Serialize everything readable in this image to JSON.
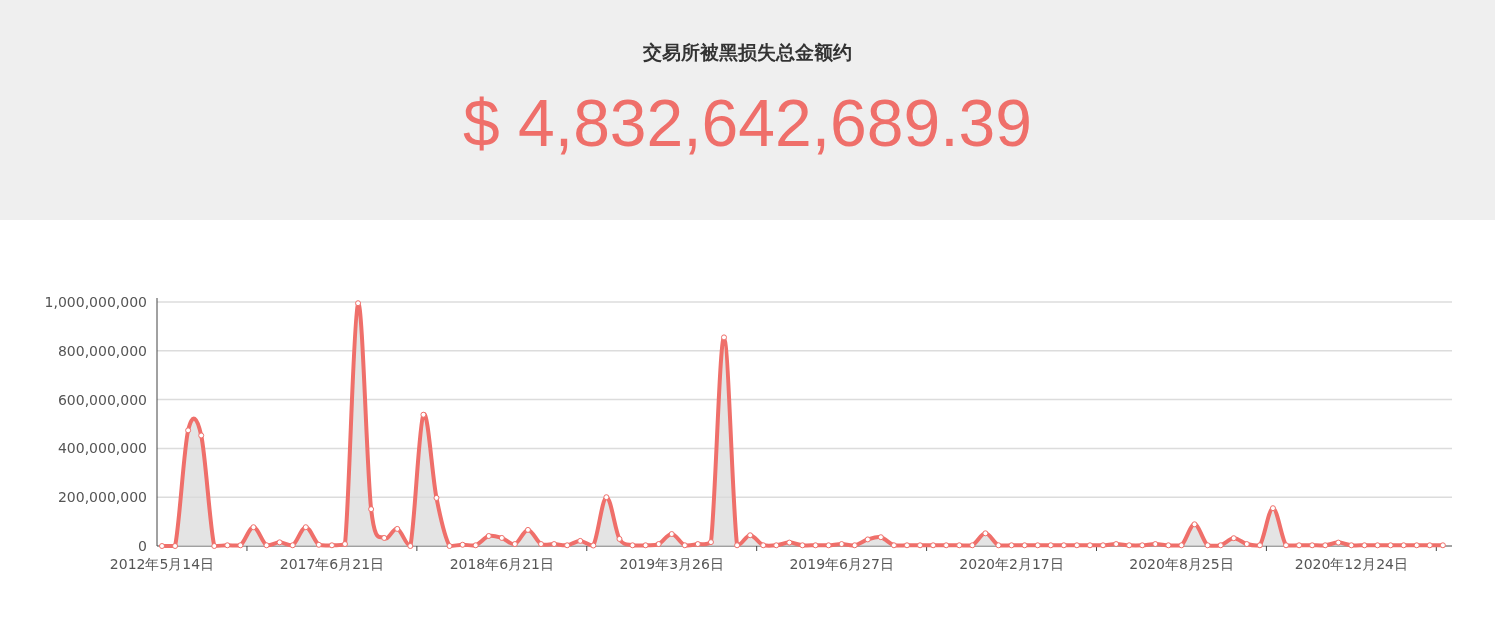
{
  "header": {
    "title": "交易所被黑损失总金额约",
    "total": "$ 4,832,642,689.39"
  },
  "chart": {
    "chart_data": {
      "type": "line",
      "categories": [
        "2012年5月14日",
        null,
        null,
        null,
        null,
        null,
        null,
        null,
        null,
        null,
        null,
        null,
        null,
        "2017年6月21日",
        null,
        null,
        null,
        null,
        null,
        null,
        null,
        null,
        null,
        null,
        null,
        null,
        "2018年6月21日",
        null,
        null,
        null,
        null,
        null,
        null,
        null,
        null,
        null,
        null,
        null,
        null,
        "2019年3月26日",
        null,
        null,
        null,
        null,
        null,
        null,
        null,
        null,
        null,
        null,
        null,
        null,
        "2019年6月27日",
        null,
        null,
        null,
        null,
        null,
        null,
        null,
        null,
        null,
        null,
        null,
        null,
        "2020年2月17日",
        null,
        null,
        null,
        null,
        null,
        null,
        null,
        null,
        null,
        null,
        null,
        null,
        "2020年8月25日",
        null,
        null,
        null,
        null,
        null,
        null,
        null,
        null,
        null,
        null,
        null,
        null,
        "2020年12月24日",
        null,
        null,
        null,
        null,
        null,
        null,
        null
      ],
      "grid": true,
      "series": [
        {
          "color": "#ef6f6a",
          "marker": true,
          "values": [
            0,
            0,
            474000000,
            453000000,
            0,
            3000000,
            3000000,
            77000000,
            3000000,
            15000000,
            3000000,
            77000000,
            5000000,
            3000000,
            8000000,
            995000000,
            151000000,
            33000000,
            70000000,
            0,
            538000000,
            197000000,
            0,
            5000000,
            3000000,
            41000000,
            33000000,
            8000000,
            66000000,
            8000000,
            8000000,
            3000000,
            21000000,
            2000000,
            200000000,
            29000000,
            3000000,
            3000000,
            8000000,
            49000000,
            3000000,
            8000000,
            16000000,
            855000000,
            3000000,
            44000000,
            3000000,
            3000000,
            14000000,
            3000000,
            3000000,
            3000000,
            8000000,
            3000000,
            27000000,
            36000000,
            3000000,
            3000000,
            3000000,
            3000000,
            3000000,
            3000000,
            3000000,
            52000000,
            3000000,
            3000000,
            3000000,
            3000000,
            3000000,
            3000000,
            3000000,
            3000000,
            3000000,
            8000000,
            3000000,
            3000000,
            8000000,
            3000000,
            3000000,
            89000000,
            3000000,
            3000000,
            32000000,
            8000000,
            3000000,
            155000000,
            3000000,
            3000000,
            3000000,
            3000000,
            14000000,
            3000000,
            3000000,
            3000000,
            3000000,
            3000000,
            3000000,
            3000000,
            3000000
          ]
        }
      ],
      "yticks": [
        {
          "value": 0,
          "label": "0"
        },
        {
          "value": 200000000,
          "label": "200,000,000"
        },
        {
          "value": 400000000,
          "label": "400,000,000"
        },
        {
          "value": 600000000,
          "label": "600,000,000"
        },
        {
          "value": 800000000,
          "label": "800,000,000"
        },
        {
          "value": 1000000000,
          "label": "1,000,000,000"
        }
      ],
      "ylim": [
        0,
        1000000000
      ]
    }
  }
}
